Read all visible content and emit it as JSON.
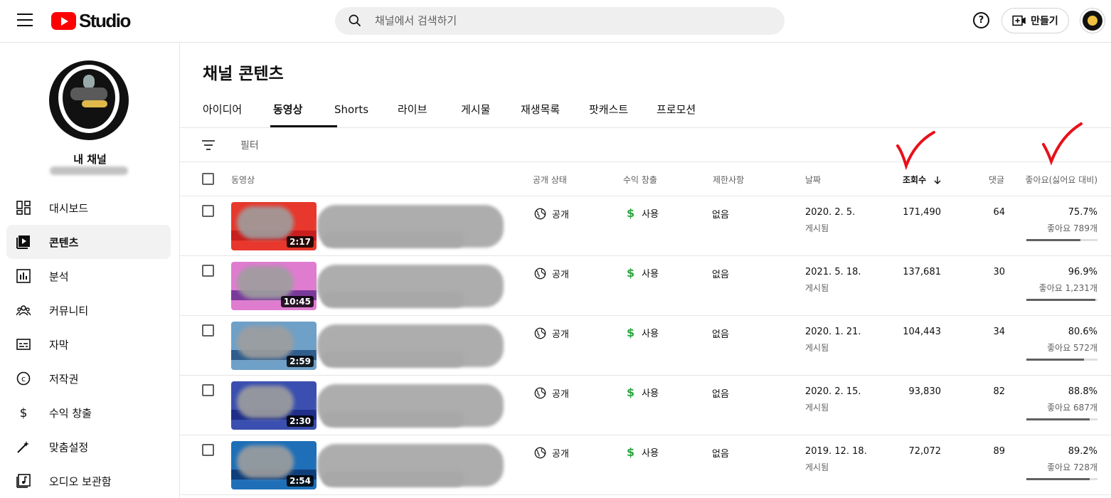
{
  "header": {
    "logo_text": "Studio",
    "search_placeholder": "채널에서 검색하기",
    "help_label": "?",
    "create_label": "만들기"
  },
  "sidebar": {
    "channel_label": "내 채널",
    "items": [
      {
        "label": "대시보드",
        "icon": "dashboard-icon",
        "active": false
      },
      {
        "label": "콘텐츠",
        "icon": "content-icon",
        "active": true
      },
      {
        "label": "분석",
        "icon": "analytics-icon",
        "active": false
      },
      {
        "label": "커뮤니티",
        "icon": "community-icon",
        "active": false
      },
      {
        "label": "자막",
        "icon": "subtitles-icon",
        "active": false
      },
      {
        "label": "저작권",
        "icon": "copyright-icon",
        "active": false
      },
      {
        "label": "수익 창출",
        "icon": "monetization-icon",
        "active": false
      },
      {
        "label": "맞춤설정",
        "icon": "customization-icon",
        "active": false
      },
      {
        "label": "오디오 보관함",
        "icon": "audio-library-icon",
        "active": false
      }
    ]
  },
  "main": {
    "title": "채널 콘텐츠",
    "tabs": [
      {
        "label": "아이디어",
        "active": false
      },
      {
        "label": "동영상",
        "active": true
      },
      {
        "label": "Shorts",
        "active": false
      },
      {
        "label": "라이브",
        "active": false
      },
      {
        "label": "게시물",
        "active": false
      },
      {
        "label": "재생목록",
        "active": false
      },
      {
        "label": "팟캐스트",
        "active": false
      },
      {
        "label": "프로모션",
        "active": false
      }
    ],
    "filter_label": "필터",
    "columns": {
      "video": "동영상",
      "visibility": "공개 상태",
      "monetization": "수익 창출",
      "restrictions": "제한사항",
      "date": "날짜",
      "views": "조회수",
      "comments": "댓글",
      "likes": "좋아요(싫어요 대비)"
    },
    "rows": [
      {
        "duration": "2:17",
        "visibility": "공개",
        "monetization": "사용",
        "restrictions": "없음",
        "date": "2020. 2. 5.",
        "date_status": "게시됨",
        "views": "171,490",
        "comments": "64",
        "like_pct": "75.7%",
        "likes": "좋아요 789개",
        "like_ratio": 0.757,
        "thumb_color": "#e8372c",
        "band_color": "#c81e1e"
      },
      {
        "duration": "10:45",
        "visibility": "공개",
        "monetization": "사용",
        "restrictions": "없음",
        "date": "2021. 5. 18.",
        "date_status": "게시됨",
        "views": "137,681",
        "comments": "30",
        "like_pct": "96.9%",
        "likes": "좋아요 1,231개",
        "like_ratio": 0.969,
        "thumb_color": "#e07cd0",
        "band_color": "#7a3a9a"
      },
      {
        "duration": "2:59",
        "visibility": "공개",
        "monetization": "사용",
        "restrictions": "없음",
        "date": "2020. 1. 21.",
        "date_status": "게시됨",
        "views": "104,443",
        "comments": "34",
        "like_pct": "80.6%",
        "likes": "좋아요 572개",
        "like_ratio": 0.806,
        "thumb_color": "#6fa0c8",
        "band_color": "#2f5d8c"
      },
      {
        "duration": "2:30",
        "visibility": "공개",
        "monetization": "사용",
        "restrictions": "없음",
        "date": "2020. 2. 15.",
        "date_status": "게시됨",
        "views": "93,830",
        "comments": "82",
        "like_pct": "88.8%",
        "likes": "좋아요 687개",
        "like_ratio": 0.888,
        "thumb_color": "#3a4fb0",
        "band_color": "#1e2e8a"
      },
      {
        "duration": "2:54",
        "visibility": "공개",
        "monetization": "사용",
        "restrictions": "없음",
        "date": "2019. 12. 18.",
        "date_status": "게시됨",
        "views": "72,072",
        "comments": "89",
        "like_pct": "89.2%",
        "likes": "좋아요 728개",
        "like_ratio": 0.892,
        "thumb_color": "#1e6fb8",
        "band_color": "#0f3f7a"
      }
    ]
  },
  "colors": {
    "brand_red": "#ff0000",
    "monetization_green": "#2ba640",
    "annotation_red": "#e8101a"
  }
}
